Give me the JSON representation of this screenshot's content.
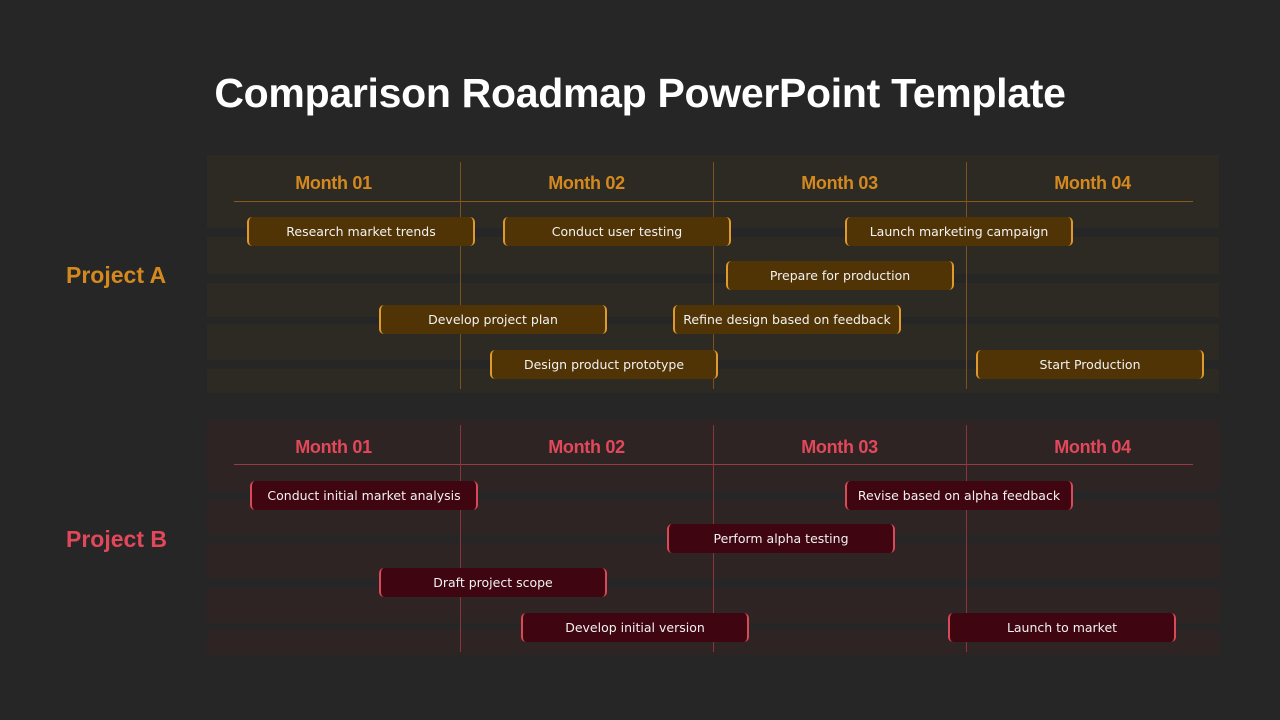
{
  "title": "Comparison Roadmap PowerPoint  Template",
  "colors": {
    "background": "#262626",
    "project_a_accent": "#d4891f",
    "project_a_bar_fill": "#513406",
    "project_a_band": "#2d2a24",
    "project_b_accent": "#e2485a",
    "project_b_bar_fill": "#3f0510",
    "project_b_band": "#2f2424"
  },
  "months": [
    "Month 01",
    "Month 02",
    "Month 03",
    "Month 04"
  ],
  "projects": [
    {
      "label": "Project A",
      "tasks": [
        {
          "label": "Research market trends",
          "start_month": 0.16,
          "row": 0
        },
        {
          "label": "Conduct user testing",
          "start_month": 1.17,
          "row": 0
        },
        {
          "label": "Launch marketing campaign",
          "start_month": 2.52,
          "row": 0
        },
        {
          "label": "Prepare for production",
          "start_month": 2.05,
          "row": 1
        },
        {
          "label": "Develop project plan",
          "start_month": 0.68,
          "row": 2
        },
        {
          "label": "Refine design based on feedback",
          "start_month": 1.84,
          "row": 2
        },
        {
          "label": "Design product prototype",
          "start_month": 1.12,
          "row": 3
        },
        {
          "label": "Start Production",
          "start_month": 3.04,
          "row": 3
        }
      ]
    },
    {
      "label": "Project B",
      "tasks": [
        {
          "label": "Conduct initial market analysis",
          "start_month": 0.17,
          "row": 0
        },
        {
          "label": "Revise based on alpha feedback",
          "start_month": 2.52,
          "row": 0
        },
        {
          "label": "Perform alpha testing",
          "start_month": 1.82,
          "row": 1
        },
        {
          "label": "Draft project scope",
          "start_month": 0.68,
          "row": 2
        },
        {
          "label": "Develop initial version",
          "start_month": 1.24,
          "row": 3
        },
        {
          "label": "Launch to market",
          "start_month": 2.93,
          "row": 3
        }
      ]
    }
  ]
}
